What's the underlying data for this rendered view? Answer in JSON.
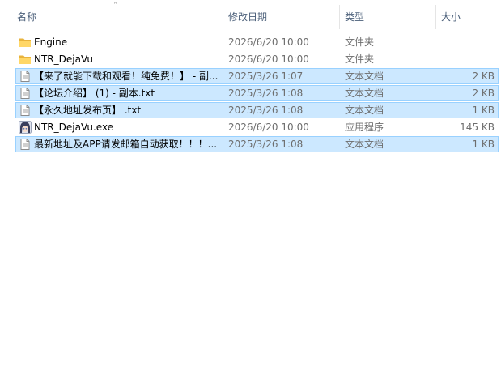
{
  "columns": {
    "name": "名称",
    "modified": "修改日期",
    "type": "类型",
    "size": "大小"
  },
  "sort_indicator": "˄",
  "files": [
    {
      "name": "Engine",
      "modified": "2026/6/20 10:00",
      "type": "文件夹",
      "size": "",
      "icon": "folder-icon",
      "selected": false
    },
    {
      "name": "NTR_DejaVu",
      "modified": "2026/6/20 10:00",
      "type": "文件夹",
      "size": "",
      "icon": "folder-icon",
      "selected": false
    },
    {
      "name": "【来了就能下载和观看！纯免费！】 - 副...",
      "modified": "2025/3/26 1:07",
      "type": "文本文档",
      "size": "2 KB",
      "icon": "text-document-icon",
      "selected": true
    },
    {
      "name": "【论坛介绍】 (1) - 副本.txt",
      "modified": "2025/3/26 1:08",
      "type": "文本文档",
      "size": "2 KB",
      "icon": "text-document-icon",
      "selected": true
    },
    {
      "name": "【永久地址发布页】 .txt",
      "modified": "2025/3/26 1:08",
      "type": "文本文档",
      "size": "1 KB",
      "icon": "text-document-icon",
      "selected": true
    },
    {
      "name": "NTR_DejaVu.exe",
      "modified": "2026/6/20 10:00",
      "type": "应用程序",
      "size": "145 KB",
      "icon": "app-character-icon",
      "selected": false
    },
    {
      "name": "最新地址及APP请发邮箱自动获取！！！...",
      "modified": "2025/3/26 1:08",
      "type": "文本文档",
      "size": "1 KB",
      "icon": "text-document-icon",
      "selected": true
    }
  ],
  "colors": {
    "selection_fill": "#cce8ff",
    "selection_border": "#99d1ff",
    "folder": "#ffd767",
    "header_text": "#4c607a"
  }
}
